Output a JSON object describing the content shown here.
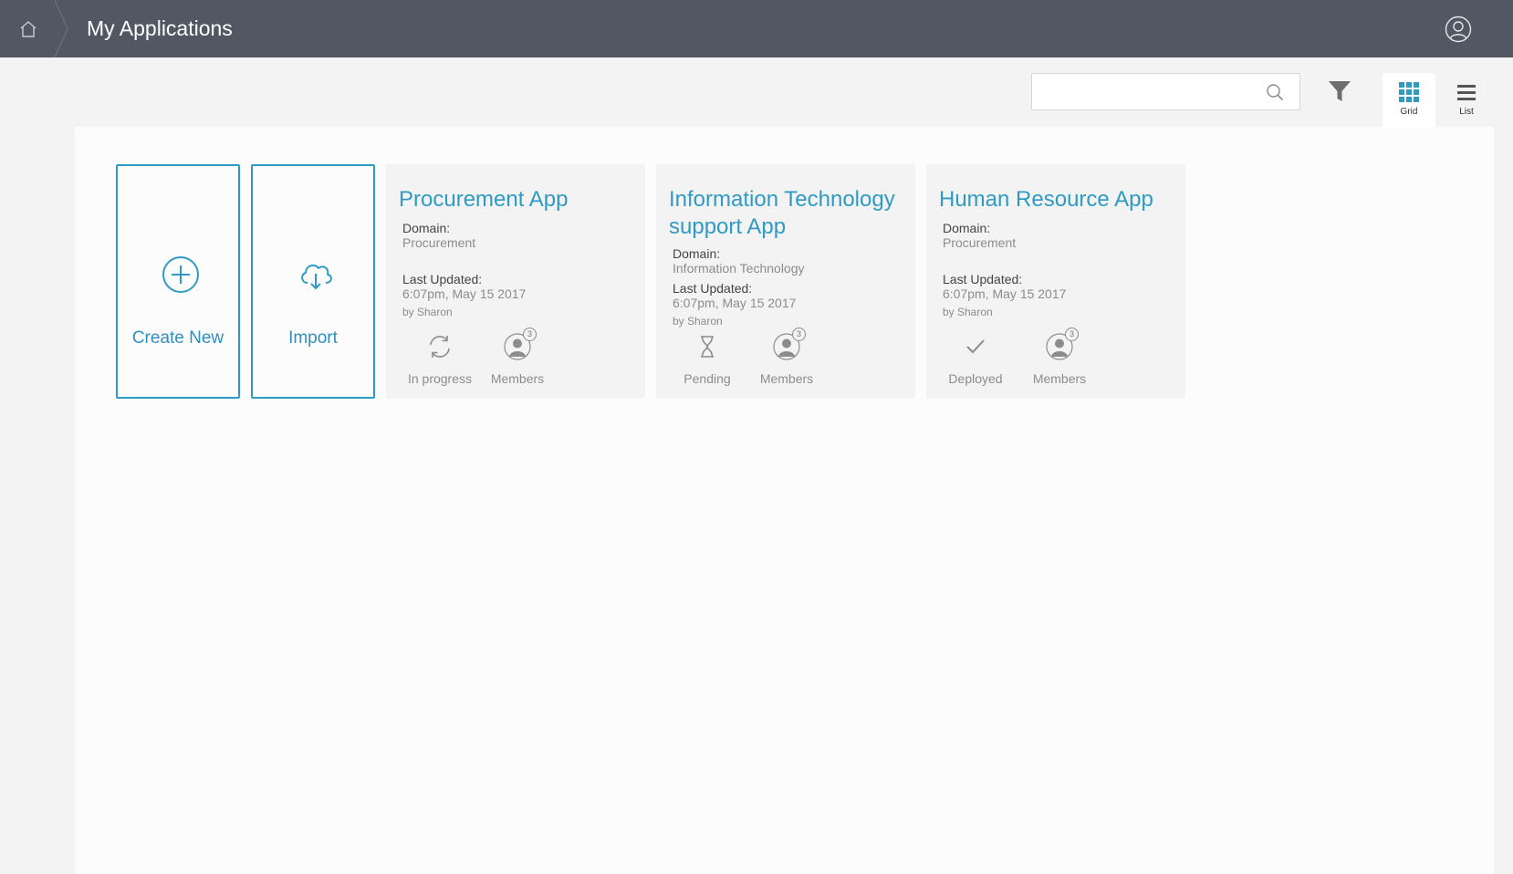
{
  "header": {
    "title": "My Applications",
    "home_icon": "home-icon",
    "user_icon": "user-icon"
  },
  "toolbar": {
    "search": {
      "value": "",
      "placeholder": ""
    },
    "filter_icon": "filter-icon",
    "views": [
      {
        "label": "Grid",
        "active": true
      },
      {
        "label": "List",
        "active": false
      }
    ]
  },
  "actions": [
    {
      "label": "Create New",
      "icon": "plus-circle-icon"
    },
    {
      "label": "Import",
      "icon": "cloud-download-icon"
    }
  ],
  "cards": [
    {
      "title": "Procurement App",
      "domain_label": "Domain:",
      "domain": "Procurement",
      "updated_label": "Last Updated:",
      "updated": "6:07pm, May 15 2017",
      "by": "by Sharon",
      "status": "In progress",
      "status_icon": "sync-icon",
      "members_label": "Members",
      "members_count": "3"
    },
    {
      "title": "Information Technology support App",
      "domain_label": "Domain:",
      "domain": "Information Technology",
      "updated_label": "Last Updated:",
      "updated": "6:07pm, May 15 2017",
      "by": "by Sharon",
      "status": "Pending",
      "status_icon": "hourglass-icon",
      "members_label": "Members",
      "members_count": "3"
    },
    {
      "title": "Human Resource App",
      "domain_label": "Domain:",
      "domain": "Procurement",
      "updated_label": "Last Updated:",
      "updated": "6:07pm, May 15 2017",
      "by": "by Sharon",
      "status": "Deployed",
      "status_icon": "check-icon",
      "members_label": "Members",
      "members_count": "3"
    }
  ],
  "colors": {
    "header_bg": "#515763",
    "accent": "#2f9bc4",
    "page_bg": "#f3f3f3",
    "muted_text": "#8c8c8c"
  }
}
